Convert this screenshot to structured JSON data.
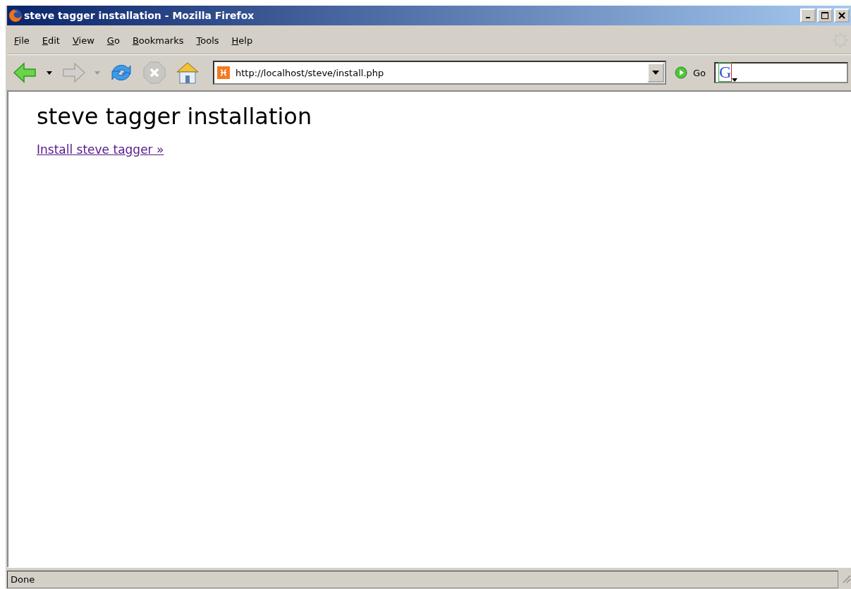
{
  "window": {
    "title": "steve tagger installation - Mozilla Firefox"
  },
  "menu": [
    "File",
    "Edit",
    "View",
    "Go",
    "Bookmarks",
    "Tools",
    "Help"
  ],
  "toolbar": {
    "address": "http://localhost/steve/install.php",
    "go_label": "Go",
    "search_engine_glyph": "G"
  },
  "page": {
    "heading": "steve tagger installation",
    "link": "Install steve tagger »"
  },
  "status_bar": "Done"
}
